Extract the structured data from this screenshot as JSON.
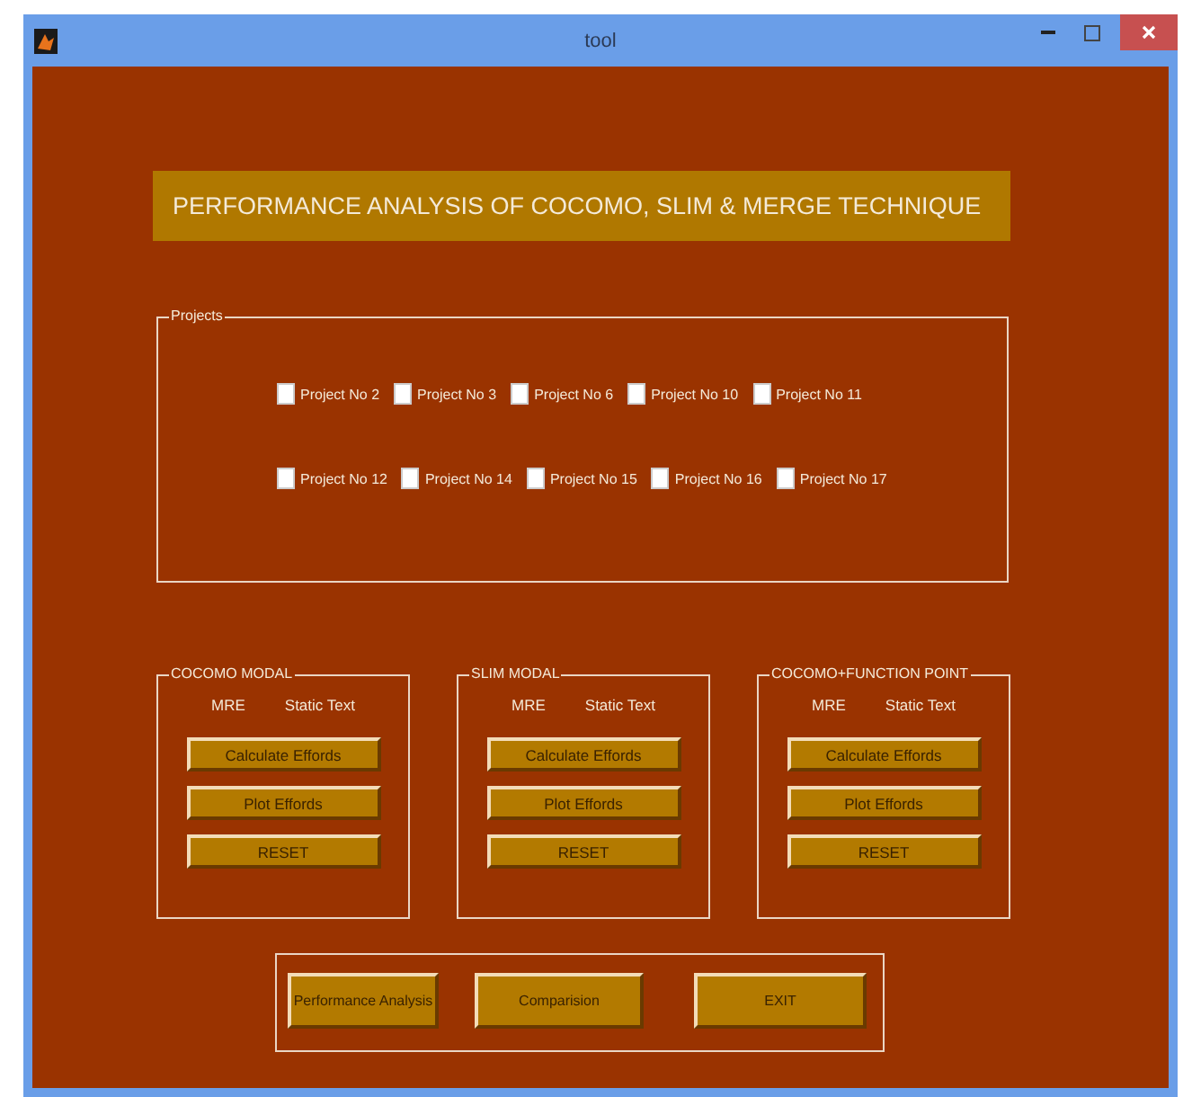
{
  "window": {
    "title": "tool"
  },
  "banner": {
    "text": "PERFORMANCE ANALYSIS OF COCOMO, SLIM & MERGE TECHNIQUE"
  },
  "projects": {
    "legend": "Projects",
    "rows": [
      [
        {
          "label": "Project No 2",
          "checked": false
        },
        {
          "label": "Project No 3",
          "checked": false
        },
        {
          "label": "Project No 6",
          "checked": false
        },
        {
          "label": "Project No 10",
          "checked": false
        },
        {
          "label": "Project No 11",
          "checked": false
        }
      ],
      [
        {
          "label": "Project No 12",
          "checked": false
        },
        {
          "label": "Project No 14",
          "checked": false
        },
        {
          "label": "Project No 15",
          "checked": false
        },
        {
          "label": "Project No 16",
          "checked": false
        },
        {
          "label": "Project No 17",
          "checked": false
        }
      ]
    ]
  },
  "models": [
    {
      "legend": "COCOMO MODAL",
      "mre_label": "MRE",
      "value": "Static Text",
      "buttons": [
        "Calculate Effords",
        "Plot Effords",
        "RESET"
      ]
    },
    {
      "legend": "SLIM MODAL",
      "mre_label": "MRE",
      "value": "Static Text",
      "buttons": [
        "Calculate Effords",
        "Plot Effords",
        "RESET"
      ]
    },
    {
      "legend": "COCOMO+FUNCTION POINT",
      "mre_label": "MRE",
      "value": "Static Text",
      "buttons": [
        "Calculate Effords",
        "Plot Effords",
        "RESET"
      ]
    }
  ],
  "actions": [
    "Performance Analysis",
    "Comparision",
    "EXIT"
  ]
}
